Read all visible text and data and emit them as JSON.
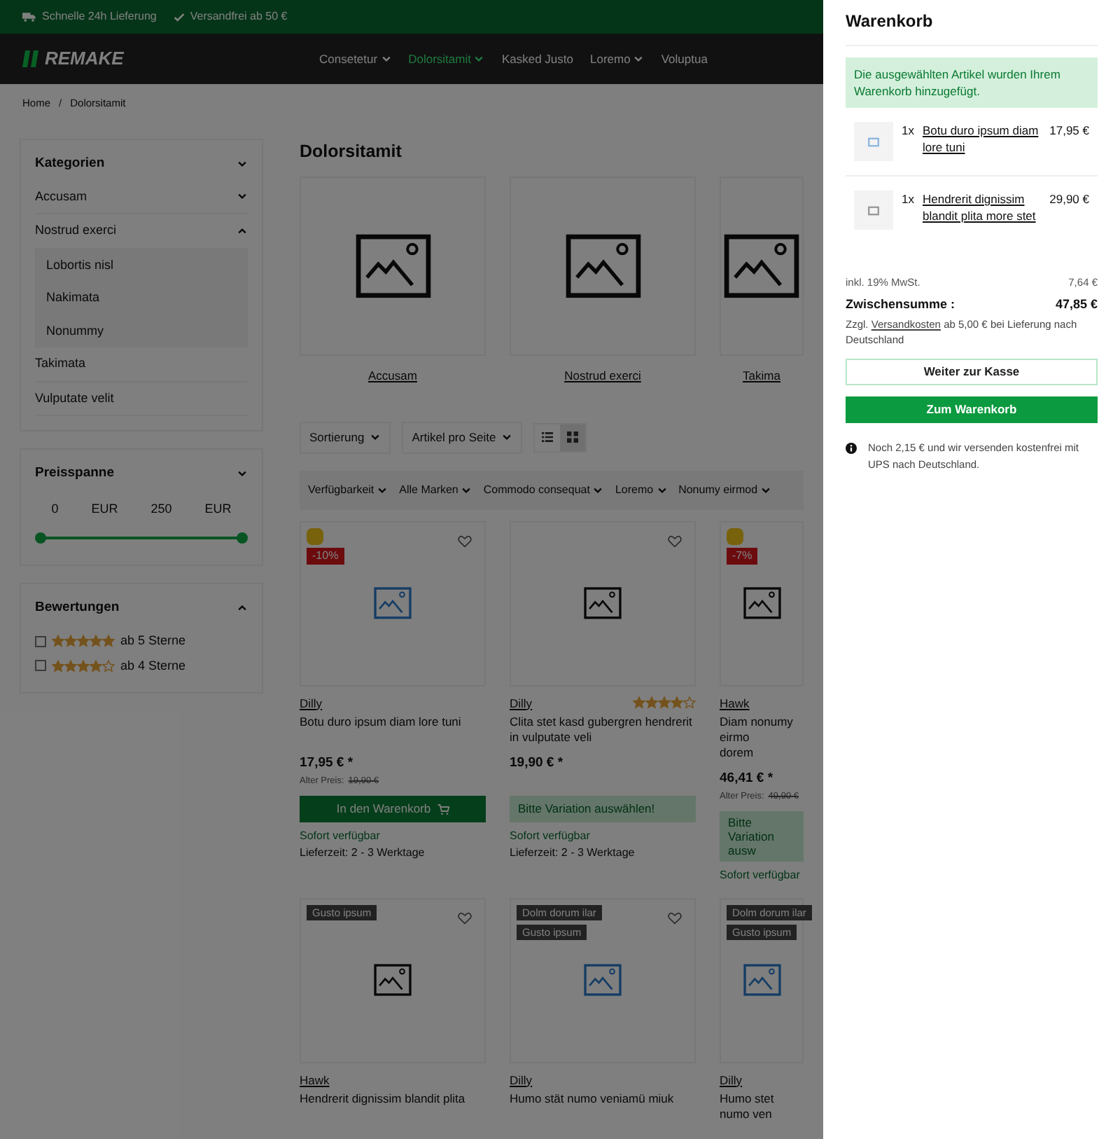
{
  "topbar": {
    "items": [
      {
        "kind": "truck",
        "label": "Schnelle 24h Lieferung"
      },
      {
        "kind": "check",
        "label": "Versandfrei ab 50 €"
      }
    ]
  },
  "header": {
    "logo": "REMAKE",
    "nav": [
      {
        "label": "Consetetur",
        "dropdown": true,
        "selected": false
      },
      {
        "label": "Dolorsitamit",
        "dropdown": true,
        "selected": true
      },
      {
        "label": "Kasked Justo",
        "dropdown": false,
        "selected": false
      },
      {
        "label": "Loremo",
        "dropdown": true,
        "selected": false
      },
      {
        "label": "Voluptua",
        "dropdown": false,
        "selected": false
      }
    ]
  },
  "breadcrumb": {
    "items": [
      "Home",
      "Dolorsitamit"
    ],
    "separator": "/"
  },
  "sidebar": {
    "categories": {
      "title": "Kategorien",
      "expanded": true,
      "items": [
        {
          "label": "Accusam",
          "expanded": false,
          "has_children": true
        },
        {
          "label": "Nostrud exerci",
          "expanded": true,
          "has_children": true,
          "children": [
            {
              "label": "Lobortis nisl"
            },
            {
              "label": "Nakimata"
            },
            {
              "label": "Nonummy"
            }
          ]
        },
        {
          "label": "Takimata",
          "expanded": false,
          "has_children": false
        },
        {
          "label": "Vulputate velit",
          "expanded": false,
          "has_children": false
        }
      ]
    },
    "price": {
      "title": "Preisspanne",
      "expanded": true,
      "min": "0",
      "min_currency": "EUR",
      "max": "250",
      "max_currency": "EUR",
      "handles": [
        {
          "level": 0
        },
        {
          "level": 1
        }
      ]
    },
    "ratings": {
      "title": "Bewertungen",
      "expanded": true,
      "options": [
        {
          "stars": 5,
          "label": "ab 5 Sterne",
          "checked": false
        },
        {
          "stars": 4,
          "label": "ab 4 Sterne",
          "checked": false
        }
      ]
    }
  },
  "main": {
    "title": "Dolorsitamit",
    "category_tiles": [
      "Accusam",
      "Nostrud exerci",
      "Takima"
    ],
    "toolbar": {
      "sort": "Sortierung",
      "per_page": "Artikel pro Seite",
      "views": [
        {
          "kind": "list",
          "selected": false
        },
        {
          "kind": "grid",
          "selected": true
        }
      ]
    },
    "filters": [
      "Verfügbarkeit",
      "Alle Marken",
      "Commodo consequat",
      "Loremo",
      "Nonumy eirmod"
    ],
    "products": [
      {
        "badge_icon": true,
        "discount": "-10%",
        "wishlist": true,
        "image": {
          "kind": "accent"
        },
        "brand": "Dilly",
        "name": "Botu duro ipsum diam lore tuni",
        "price": "17,95 € *",
        "old_price_label": "Alter Preis:",
        "old_price": "19,90 €",
        "button": {
          "kind": "primary",
          "label": "In den Warenkorb"
        },
        "availability": "Sofort verfügbar",
        "delivery": "Lieferzeit: 2 - 3 Werktage"
      },
      {
        "badge_icon": false,
        "wishlist": true,
        "image": {
          "kind": "plain"
        },
        "brand": "Dilly",
        "stars": 4,
        "name": "Clita stet kasd gubergren hendrerit in vulputate veli",
        "price": "19,90 € *",
        "button": {
          "kind": "variation",
          "label": "Bitte Variation auswählen!"
        },
        "availability": "Sofort verfügbar",
        "delivery": "Lieferzeit: 2 - 3 Werktage"
      },
      {
        "badge_icon": true,
        "discount": "-7%",
        "wishlist": false,
        "image": {
          "kind": "plain"
        },
        "brand": "Hawk",
        "name": "Diam nonumy eirmo",
        "name_line_2": "dorem",
        "price": "46,41 € *",
        "old_price_label": "Alter Preis:",
        "old_price": "49,90 €",
        "button": {
          "kind": "variation",
          "label": "Bitte Variation ausw"
        },
        "availability": "Sofort verfügbar"
      },
      {
        "badge_icon": false,
        "tags": [
          "Gusto ipsum"
        ],
        "wishlist": true,
        "image": {
          "kind": "plain"
        },
        "brand": "Hawk",
        "name": "Hendrerit dignissim blandit plita"
      },
      {
        "badge_icon": false,
        "tags": [
          "Dolm dorum ilar",
          "Gusto ipsum"
        ],
        "wishlist": true,
        "image": {
          "kind": "accent"
        },
        "brand": "Dilly",
        "name": "Humo stät numo veniamü miuk"
      },
      {
        "badge_icon": false,
        "tags": [
          "Dolm dorum ilar",
          "Gusto ipsum"
        ],
        "wishlist": false,
        "image": {
          "kind": "accent"
        },
        "brand": "Dilly",
        "name": "Humo stet numo ven"
      }
    ]
  },
  "cart": {
    "title": "Warenkorb",
    "alert": "Die ausgewählten Artikel wurden Ihrem Warenkorb hinzugefügt.",
    "items": [
      {
        "qty": "1x",
        "name": "Botu duro ipsum diam lore tuni",
        "price": "17,95 €",
        "thumb": {
          "kind": "accent"
        }
      },
      {
        "qty": "1x",
        "name": "Hendrerit dignissim blandit plita more stet",
        "price": "29,90 €",
        "thumb": {
          "kind": "plain"
        }
      }
    ],
    "tax_label": "inkl. 19% MwSt.",
    "tax_value": "7,64 €",
    "subtotal_label": "Zwischensumme :",
    "subtotal_value": "47,85 €",
    "shipping_before": "Zzgl.",
    "shipping_link": "Versandkosten",
    "shipping_after": "ab 5,00 € bei Lieferung nach Deutschland",
    "buttons": [
      {
        "kind": "outline",
        "label": "Weiter zur Kasse"
      },
      {
        "kind": "primary",
        "label": "Zum Warenkorb"
      }
    ],
    "info": "Noch 2,15 € und wir versenden kostenfrei mit UPS nach Deutschland."
  }
}
